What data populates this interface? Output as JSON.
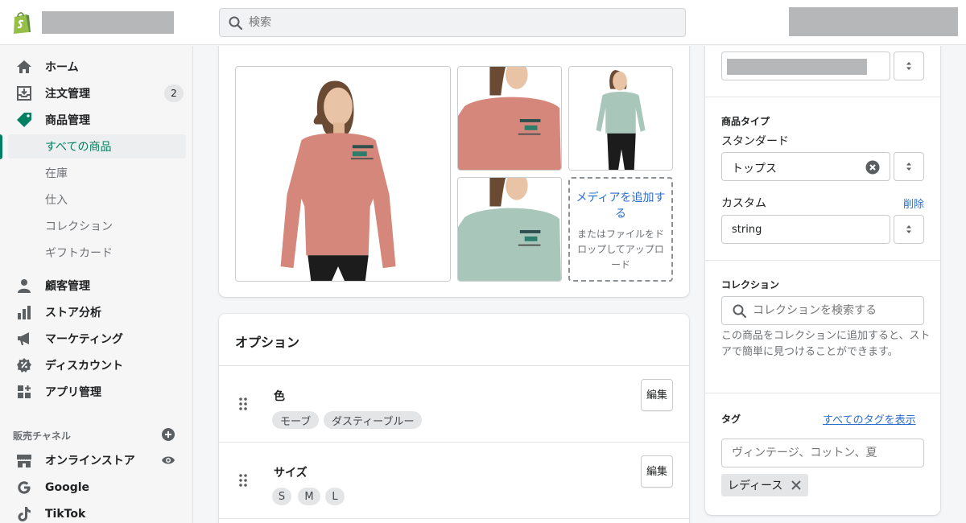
{
  "topbar": {
    "search_placeholder": "検索"
  },
  "sidebar": {
    "nav": [
      {
        "label": "ホーム",
        "icon": "home-icon"
      },
      {
        "label": "注文管理",
        "icon": "orders-icon",
        "badge": "2"
      },
      {
        "label": "商品管理",
        "icon": "products-tag-icon"
      }
    ],
    "product_sub": [
      "すべての商品",
      "在庫",
      "仕入",
      "コレクション",
      "ギフトカード"
    ],
    "nav2": [
      {
        "label": "顧客管理",
        "icon": "customers-icon"
      },
      {
        "label": "ストア分析",
        "icon": "analytics-icon"
      },
      {
        "label": "マーケティング",
        "icon": "marketing-icon"
      },
      {
        "label": "ディスカウント",
        "icon": "discounts-icon"
      },
      {
        "label": "アプリ管理",
        "icon": "apps-icon"
      }
    ],
    "sales_channels_heading": "販売チャネル",
    "channels": [
      {
        "label": "オンラインストア",
        "icon": "store-icon"
      },
      {
        "label": "Google",
        "icon": "google-icon"
      },
      {
        "label": "TikTok",
        "icon": "tiktok-icon"
      }
    ]
  },
  "media": {
    "add_media": "メディアを追加する",
    "drop_hint": "またはファイルをドロップしてアップロード"
  },
  "options": {
    "title": "オプション",
    "edit_label": "編集",
    "items": [
      {
        "name": "色",
        "values": [
          "モーブ",
          "ダスティーブルー"
        ]
      },
      {
        "name": "サイズ",
        "values": [
          "S",
          "M",
          "L"
        ]
      }
    ]
  },
  "organization": {
    "product_type_heading": "商品タイプ",
    "standard_label": "スタンダード",
    "standard_value": "トップス",
    "custom_label": "カスタム",
    "delete_link": "削除",
    "custom_value": "string",
    "collections_heading": "コレクション",
    "collections_placeholder": "コレクションを検索する",
    "collections_help": "この商品をコレクションに追加すると、ストアで簡単に見つけることができます。",
    "tags_heading": "タグ",
    "show_all_tags": "すべてのタグを表示",
    "tags_placeholder": "ヴィンテージ、コットン、夏",
    "tags": [
      "レディース"
    ]
  },
  "colors": {
    "accent_green": "#008060",
    "link_blue": "#2c6ecb",
    "mauve_shirt": "#d4877a",
    "dusty_blue_shirt": "#a9c6bb"
  }
}
